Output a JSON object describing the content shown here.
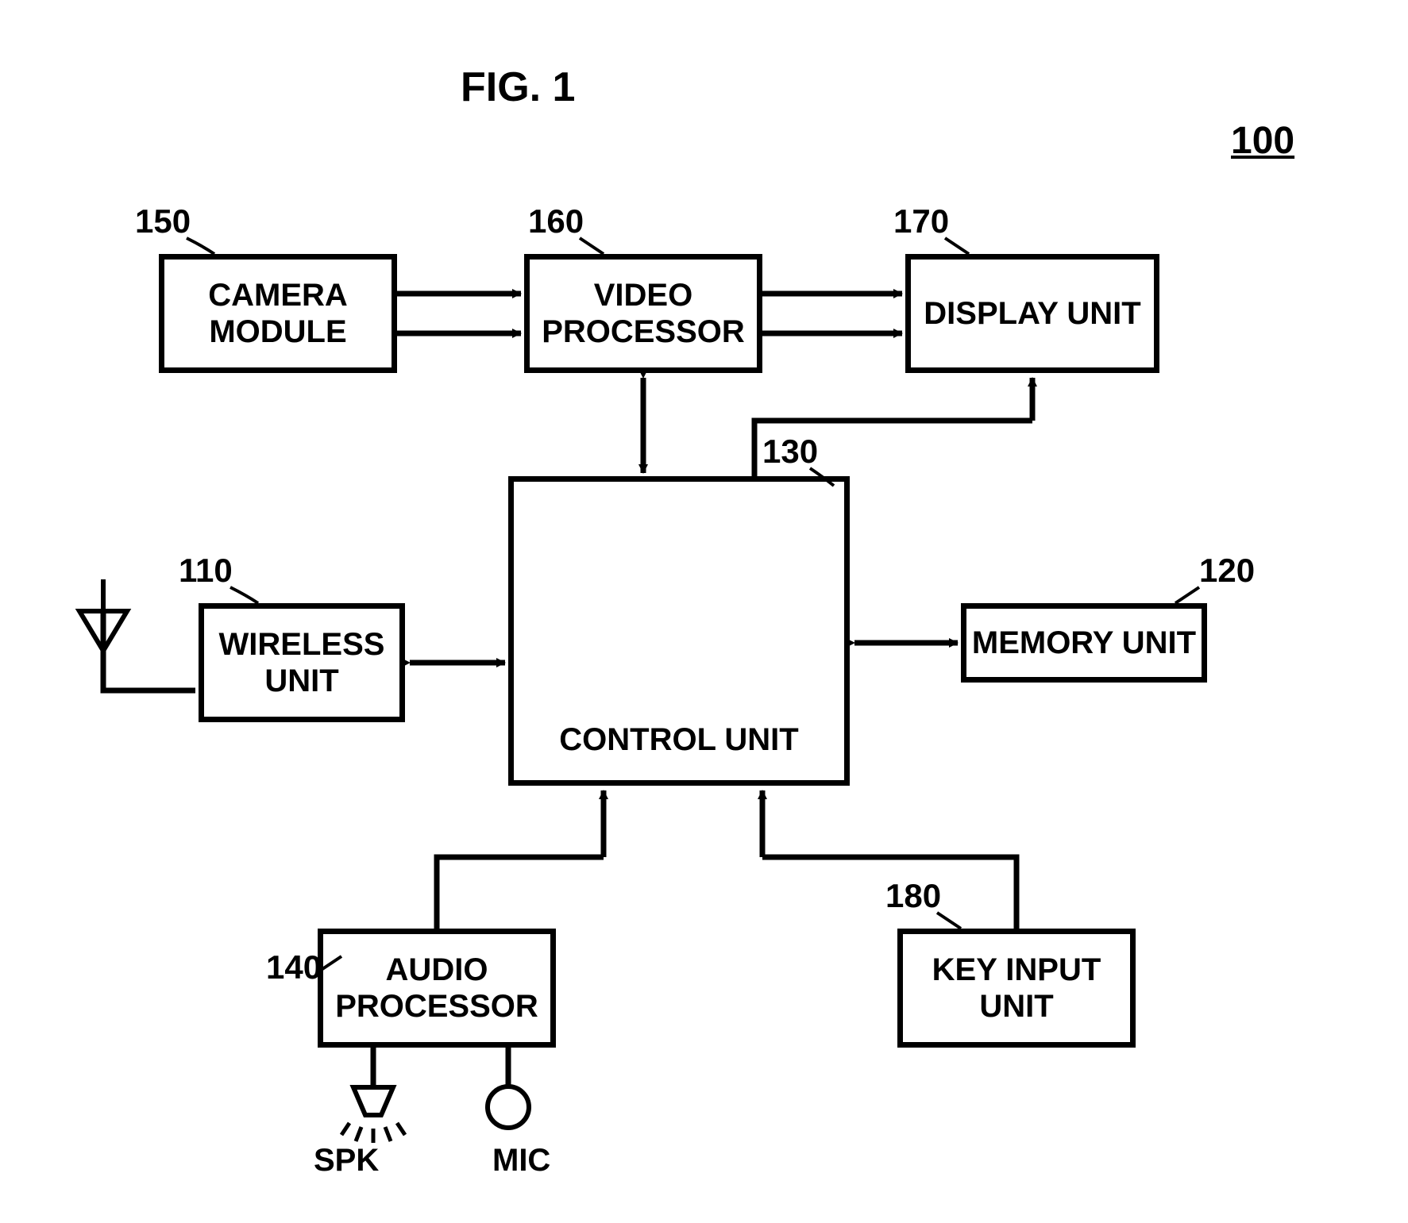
{
  "figure": {
    "title": "FIG. 1",
    "system_ref": "100"
  },
  "blocks": {
    "camera": {
      "label": "CAMERA\nMODULE",
      "ref": "150"
    },
    "video": {
      "label": "VIDEO\nPROCESSOR",
      "ref": "160"
    },
    "display": {
      "label": "DISPLAY UNIT",
      "ref": "170"
    },
    "wireless": {
      "label": "WIRELESS\nUNIT",
      "ref": "110"
    },
    "control": {
      "label": "CONTROL UNIT",
      "ref": "130"
    },
    "memory": {
      "label": "MEMORY UNIT",
      "ref": "120"
    },
    "audio": {
      "label": "AUDIO\nPROCESSOR",
      "ref": "140"
    },
    "keyinput": {
      "label": "KEY INPUT\nUNIT",
      "ref": "180"
    }
  },
  "peripherals": {
    "speaker": "SPK",
    "mic": "MIC"
  }
}
